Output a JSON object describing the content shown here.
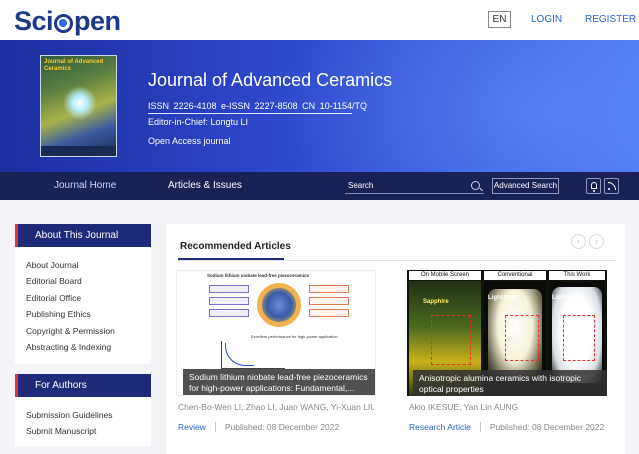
{
  "header": {
    "logo_text": "SciOpen",
    "language": "EN",
    "login": "LOGIN",
    "register": "REGISTER"
  },
  "journal": {
    "title": "Journal of Advanced Ceramics",
    "issn_line": "ISSN 2226-4108   e-ISSN 2227-8508   CN 10-1154/TQ",
    "editor": "Editor-in-Chief: Longtu LI",
    "access": "Open Access journal",
    "cover_title": "Journal of Advanced Ceramics"
  },
  "nav": {
    "home": "Journal Home",
    "issues": "Articles & Issues",
    "search_placeholder": "Search",
    "advanced_search": "Advanced Search"
  },
  "sidebar": {
    "about_header": "About This Journal",
    "about_items": [
      "About Journal",
      "Editorial Board",
      "Editorial Office",
      "Publishing Ethics",
      "Copyright & Permission",
      "Abstracting & Indexing"
    ],
    "authors_header": "For Authors",
    "authors_items": [
      "Submission Guidelines",
      "Submit Manuscript"
    ]
  },
  "recommended": {
    "title": "Recommended Articles",
    "prev": "‹",
    "next": "›",
    "articles": [
      {
        "caption_line1": "Sodium lithium niobate lead-free piezoceramics",
        "caption_line2": "for high-power applications: Fundamental,...",
        "authors": "Chen-Bo-Wen LI, Zhao LI, Juan WANG, Yi-Xuan LIU, Jing-Tong LU, Ze XU, Pak-Sheng SOON, Ke BI,...",
        "type": "Review",
        "date": "Published: 08 December 2022",
        "figure_title": "Sodium lithium niobate lead-free piezoceramics",
        "figure_subtitle": "Excellent performance for high-power application"
      },
      {
        "caption_line1": "Anisotropic alumina ceramics with isotropic",
        "caption_line2": "optical properties",
        "authors": "Akio IKESUE, Yan Lin AUNG",
        "type": "Research Article",
        "date": "Published: 08 December 2022",
        "panel_labels": [
          "On Mobile Screen",
          "Conventional",
          "This Work"
        ],
        "sapphire_label": "Sapphire",
        "bulb_label": "Light bulb"
      }
    ]
  },
  "colors": {
    "brand_navy": "#1a2157",
    "sidebar_header": "#1f2a78",
    "accent_red": "#d23a3a",
    "link_blue": "#2a63c9"
  }
}
